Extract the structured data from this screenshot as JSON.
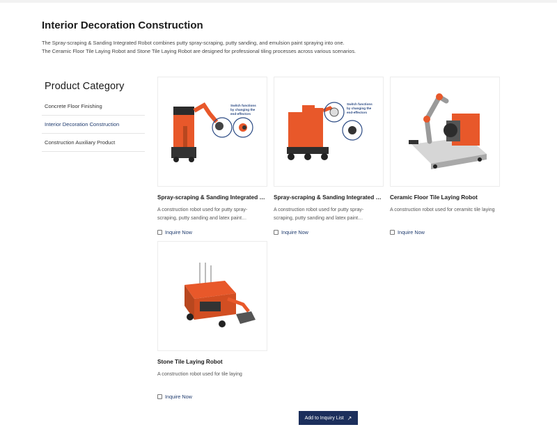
{
  "header": {
    "title": "Interior Decoration Construction",
    "intro_line1": "The Spray-scraping & Sanding Integrated Robot combines putty spray-scraping, putty sanding, and emulsion paint spraying into one.",
    "intro_line2": "The Ceramic Floor Tile Laying Robot and Stone Tile Laying Robot are designed for professional tiling processes across various scenarios."
  },
  "sidebar": {
    "title": "Product Category",
    "items": [
      {
        "label": "Concrete Floor Finishing",
        "active": false
      },
      {
        "label": "Interior Decoration Construction",
        "active": true
      },
      {
        "label": "Construction Auxiliary Product",
        "active": false
      }
    ]
  },
  "products": [
    {
      "name": "Spray-scraping & Sanding Integrated Robot",
      "desc": "A construction robot used for putty spray-scraping, putty sanding and latex paint…",
      "inquire": "Inquire Now",
      "image_callout": "Switch functions by changing the end-effectors"
    },
    {
      "name": "Spray-scraping & Sanding Integrated Robot",
      "desc": "A construction robot used for putty spray-scraping, putty sanding and latex paint…",
      "inquire": "Inquire Now",
      "image_callout": "Switch functions by changing the end-effectors"
    },
    {
      "name": "Ceramic Floor Tile Laying Robot",
      "desc": "A construction robot used for ceramitc tile laying",
      "inquire": "Inquire Now"
    },
    {
      "name": "Stone Tile Laying Robot",
      "desc": "A construction robot used for tile laying",
      "inquire": "Inquire Now"
    }
  ],
  "actions": {
    "add_to_inquiry": "Add to Inquiry List",
    "arrow": "↗"
  },
  "colors": {
    "accent": "#1c2f5c",
    "robot_orange": "#e8582a",
    "link": "#1f3b6e"
  }
}
